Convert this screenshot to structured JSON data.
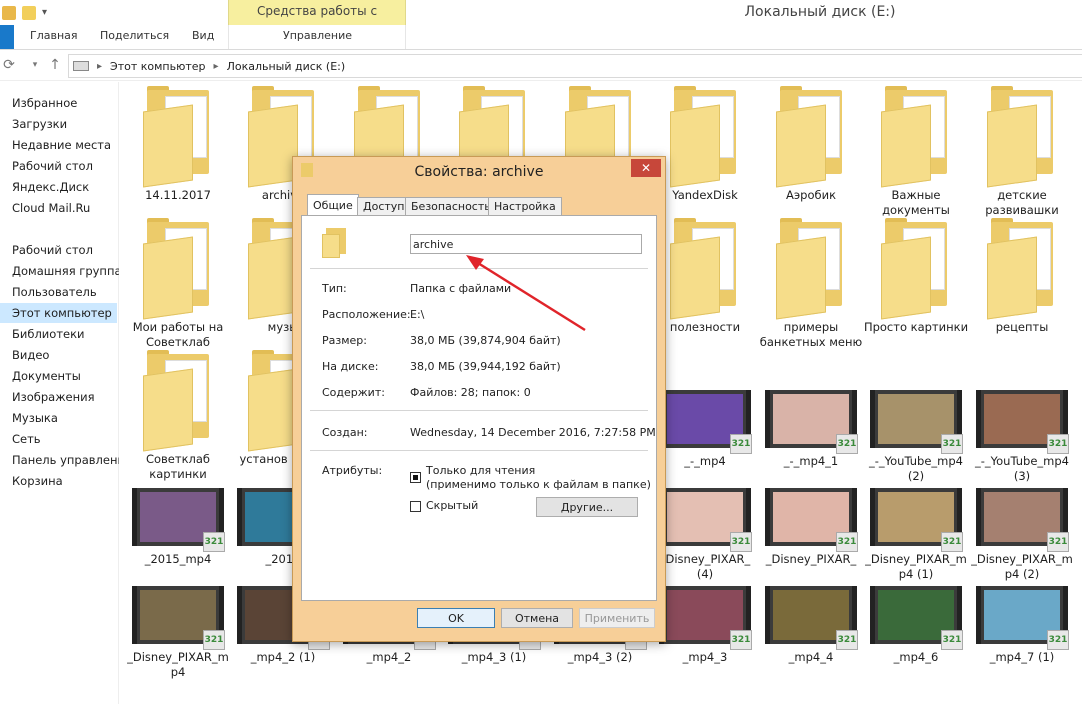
{
  "window": {
    "title": "Локальный диск (E:)",
    "context_tab": "Средства работы с рисунками",
    "ribbon_tabs": [
      "Главная",
      "Поделиться",
      "Вид",
      "Управление"
    ]
  },
  "address": {
    "crumbs": [
      "Этот компьютер",
      "Локальный диск (E:)"
    ]
  },
  "sidebar": {
    "items": [
      {
        "label": "Избранное",
        "icon": "star-icon"
      },
      {
        "label": "Загрузки",
        "icon": "download-folder-icon"
      },
      {
        "label": "Недавние места",
        "icon": "recent-places-icon"
      },
      {
        "label": "Рабочий стол",
        "icon": "desktop-icon"
      },
      {
        "label": "Яндекс.Диск",
        "icon": "yandex-disk-icon"
      },
      {
        "label": "Cloud Mail.Ru",
        "icon": "cloud-icon"
      },
      {
        "label": "Рабочий стол",
        "icon": "desktop-icon"
      },
      {
        "label": "Домашняя группа",
        "icon": "homegroup-icon"
      },
      {
        "label": "Пользователь",
        "icon": "user-icon"
      },
      {
        "label": "Этот компьютер",
        "icon": "computer-icon"
      },
      {
        "label": "Библиотеки",
        "icon": "libraries-icon"
      },
      {
        "label": "Видео",
        "icon": "video-icon"
      },
      {
        "label": "Документы",
        "icon": "documents-icon"
      },
      {
        "label": "Изображения",
        "icon": "pictures-icon"
      },
      {
        "label": "Музыка",
        "icon": "music-icon"
      },
      {
        "label": "Сеть",
        "icon": "network-icon"
      },
      {
        "label": "Панель управления",
        "icon": "control-panel-icon"
      },
      {
        "label": "Корзина",
        "icon": "recycle-bin-icon"
      }
    ]
  },
  "files": [
    {
      "label": "14.11.2017",
      "kind": "folder"
    },
    {
      "label": "archive",
      "kind": "folder"
    },
    {
      "label": "",
      "kind": "folder"
    },
    {
      "label": "",
      "kind": "folder"
    },
    {
      "label": "",
      "kind": "folder"
    },
    {
      "label": "YandexDisk",
      "kind": "folder"
    },
    {
      "label": "Аэробик",
      "kind": "folder"
    },
    {
      "label": "Важные документы",
      "kind": "folder"
    },
    {
      "label": "детские развивашки",
      "kind": "folder"
    },
    {
      "label": "Мои работы на Советклаб",
      "kind": "folder"
    },
    {
      "label": "музы",
      "kind": "folder"
    },
    {
      "label": "",
      "kind": "folder"
    },
    {
      "label": "",
      "kind": "folder"
    },
    {
      "label": "",
      "kind": "folder"
    },
    {
      "label": "полезности",
      "kind": "folder"
    },
    {
      "label": "примеры банкетных меню",
      "kind": "folder"
    },
    {
      "label": "Просто картинки",
      "kind": "folder"
    },
    {
      "label": "рецепты",
      "kind": "folder"
    },
    {
      "label": "Советклаб картинки",
      "kind": "folder"
    },
    {
      "label": "установ прогр",
      "kind": "folder"
    },
    {
      "label": "",
      "kind": "folder"
    },
    {
      "label": "",
      "kind": "folder"
    },
    {
      "label": "",
      "kind": "folder"
    },
    {
      "label": "_-_mp4",
      "kind": "video",
      "color": "#6a4aa8"
    },
    {
      "label": "_-_mp4_1",
      "kind": "video",
      "color": "#d9b3a8"
    },
    {
      "label": "_-_YouTube_mp4 (2)",
      "kind": "video",
      "color": "#a7926a"
    },
    {
      "label": "_-_YouTube_mp4 (3)",
      "kind": "video",
      "color": "#9a6a52"
    },
    {
      "label": "_2015_mp4",
      "kind": "video",
      "color": "#7a5a88"
    },
    {
      "label": "_2016",
      "kind": "video",
      "color": "#2f7a9a"
    },
    {
      "label": "",
      "kind": "video",
      "color": "#888888"
    },
    {
      "label": "",
      "kind": "video",
      "color": "#888888"
    },
    {
      "label": "",
      "kind": "video",
      "color": "#888888"
    },
    {
      "label": "_Disney_PIXAR_ (4)",
      "kind": "video",
      "color": "#e4bfb3"
    },
    {
      "label": "_Disney_PIXAR_",
      "kind": "video",
      "color": "#e0b5a8"
    },
    {
      "label": "_Disney_PIXAR_m p4 (1)",
      "kind": "video",
      "color": "#b89c6c"
    },
    {
      "label": "_Disney_PIXAR_m p4 (2)",
      "kind": "video",
      "color": "#a58070"
    },
    {
      "label": "_Disney_PIXAR_m p4",
      "kind": "video",
      "color": "#7a6a4a"
    },
    {
      "label": "_mp4_2 (1)",
      "kind": "video",
      "color": "#5a4436"
    },
    {
      "label": "_mp4_2",
      "kind": "video",
      "color": "#c9a78c"
    },
    {
      "label": "_mp4_3 (1)",
      "kind": "video",
      "color": "#e7d3a8"
    },
    {
      "label": "_mp4_3 (2)",
      "kind": "video",
      "color": "#8a7a90"
    },
    {
      "label": "_mp4_3",
      "kind": "video",
      "color": "#8a4a5a"
    },
    {
      "label": "_mp4_4",
      "kind": "video",
      "color": "#7a6a3a"
    },
    {
      "label": "_mp4_6",
      "kind": "video",
      "color": "#3a6a3a"
    },
    {
      "label": "_mp4_7 (1)",
      "kind": "video",
      "color": "#6aa8c8"
    }
  ],
  "dialog": {
    "title": "Свойства: archive",
    "close": "✕",
    "tabs": [
      "Общие",
      "Доступ",
      "Безопасность",
      "Настройка"
    ],
    "name_value": "archive",
    "props": [
      {
        "label": "Тип:",
        "value": "Папка с файлами"
      },
      {
        "label": "Расположение:",
        "value": "E:\\"
      },
      {
        "label": "Размер:",
        "value": "38,0 МБ (39,874,904 байт)"
      },
      {
        "label": "На диске:",
        "value": "38,0 МБ (39,944,192 байт)"
      },
      {
        "label": "Содержит:",
        "value": "Файлов: 28; папок: 0"
      },
      {
        "label": "Создан:",
        "value": "Wednesday, 14 December 2016, 7:27:58 PM"
      }
    ],
    "attributes_label": "Атрибуты:",
    "readonly_label": "Только для чтения",
    "readonly_note": "(применимо только к файлам в папке)",
    "readonly_checked": true,
    "hidden_label": "Скрытый",
    "hidden_checked": false,
    "other_button": "Другие...",
    "ok_button": "OK",
    "cancel_button": "Отмена",
    "apply_button": "Применить"
  },
  "colors": {
    "accent": "#1979ca",
    "context_tab": "#f7ef9f",
    "dialog_frame": "#f7cf98",
    "arrow": "#e0242a",
    "selection": "#cce8ff"
  }
}
